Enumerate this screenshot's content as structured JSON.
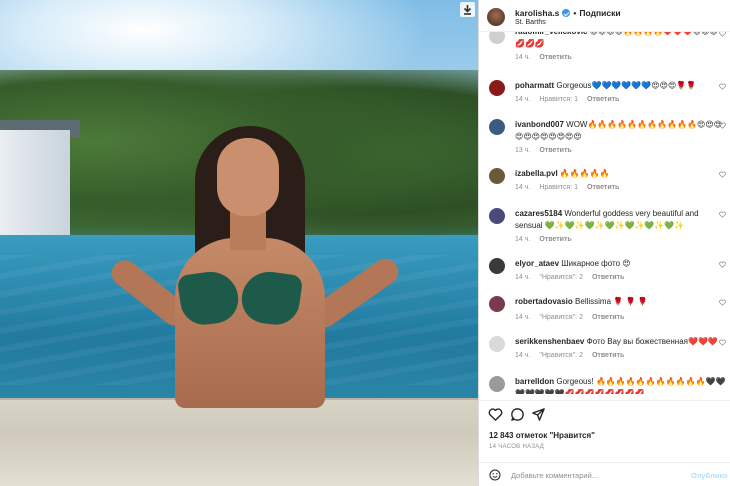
{
  "header": {
    "username": "karolisha.s",
    "follow_label": "Подписки",
    "location": "St. Barths"
  },
  "comments": [
    {
      "username": "radomir_velickovic",
      "text": "😊😊😊😊🔥🔥🔥🔥❤️❤️❤️😍😍😍💋💋💋",
      "time": "14 ч.",
      "likes": "",
      "reply": "Ответить",
      "avatar_color": "#cfcfcf"
    },
    {
      "username": "poharmatt",
      "text": "Gorgeous💙💙💙💙💙💙😍😍😍🌹🌹",
      "time": "14 ч.",
      "likes": "Нравится: 1",
      "reply": "Ответить",
      "avatar_color": "#8b1a1a"
    },
    {
      "username": "ivanbond007",
      "text": "WOW🔥🔥🔥🔥🔥🔥🔥🔥🔥🔥🔥😍😍😍😍😍😍😍😍😍😍😍",
      "time": "13 ч.",
      "likes": "",
      "reply": "Ответить",
      "avatar_color": "#3d5a80"
    },
    {
      "username": "izabella.pvl",
      "text": "🔥🔥🔥🔥🔥",
      "time": "14 ч.",
      "likes": "Нравится: 1",
      "reply": "Ответить",
      "avatar_color": "#6b5a3a"
    },
    {
      "username": "cazares5184",
      "text": "Wonderful goddess very beautiful and sensual 💚✨💚✨💚✨💚✨💚✨💚✨💚✨",
      "time": "14 ч.",
      "likes": "",
      "reply": "Ответить",
      "avatar_color": "#4a4a7a"
    },
    {
      "username": "elyor_ataev",
      "text": "Шикарное фото 😍",
      "time": "14 ч.",
      "likes": "\"Нравится\": 2",
      "reply": "Ответить",
      "avatar_color": "#3a3a3a"
    },
    {
      "username": "robertadovasio",
      "text": "Bellissima 🌹 🌹 🌹",
      "time": "14 ч.",
      "likes": "\"Нравится\": 2",
      "reply": "Ответить",
      "avatar_color": "#7a3a4a"
    },
    {
      "username": "serikkenshenbaev",
      "text": "Фото Вау вы божественная❤️❤️❤️",
      "time": "14 ч.",
      "likes": "\"Нравится\": 2",
      "reply": "Ответить",
      "avatar_color": "#d9d9d9"
    },
    {
      "username": "barrelldon",
      "text": "Gorgeous! 🔥🔥🔥🔥🔥🔥🔥🔥🔥🔥🔥🖤🖤🖤🖤🖤🖤🖤💋💋💋💋💋💋💋💋",
      "time": "",
      "likes": "",
      "reply": "",
      "avatar_color": "#9a9a9a"
    }
  ],
  "post": {
    "likes_text": "12 843 отметок \"Нравится\"",
    "time_text": "14 ЧАСОВ НАЗАД"
  },
  "composer": {
    "placeholder": "Добавьте комментарий...",
    "post_label": "Опублико"
  },
  "icons": {
    "download": "download-icon",
    "like": "heart-icon",
    "comment": "comment-icon",
    "share": "share-icon",
    "emoji": "emoji-icon"
  }
}
